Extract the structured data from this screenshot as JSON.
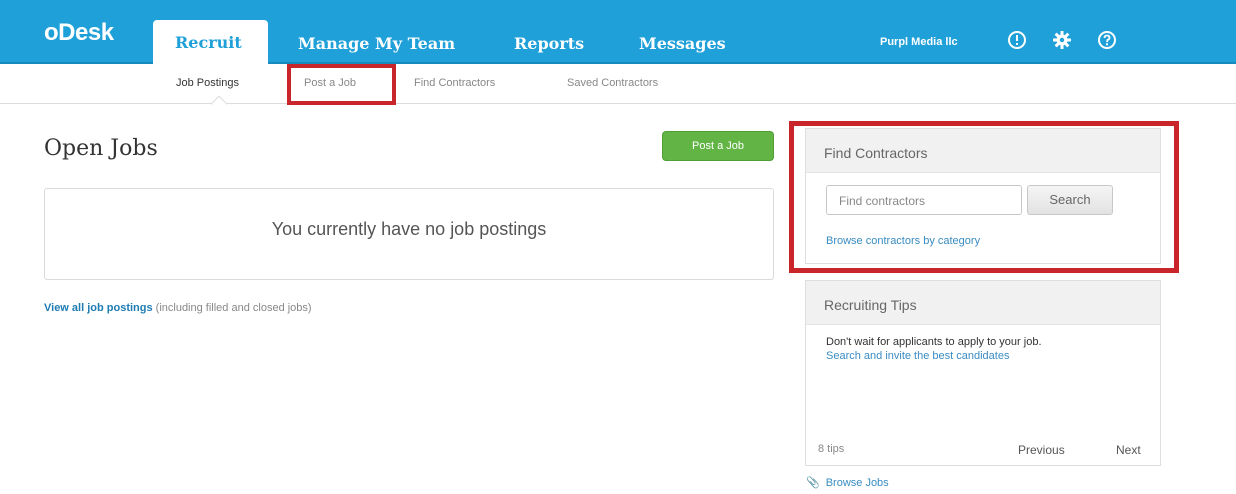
{
  "header": {
    "logo": "oDesk",
    "tabs": [
      {
        "label": "Recruit"
      },
      {
        "label": "Manage My Team"
      },
      {
        "label": "Reports"
      },
      {
        "label": "Messages"
      }
    ],
    "company": "Purpl Media llc",
    "icons": [
      "alert-icon",
      "gear-icon",
      "help-icon"
    ]
  },
  "subnav": {
    "items": [
      {
        "label": "Job Postings"
      },
      {
        "label": "Post a Job"
      },
      {
        "label": "Find Contractors"
      },
      {
        "label": "Saved Contractors"
      }
    ]
  },
  "main": {
    "title": "Open Jobs",
    "post_button": "Post a Job",
    "empty_message": "You currently have no job postings",
    "view_all_link": "View all job postings",
    "view_all_note": "(including filled and closed jobs)"
  },
  "find_panel": {
    "title": "Find Contractors",
    "search_placeholder": "Find contractors",
    "search_button": "Search",
    "browse_link": "Browse contractors by category"
  },
  "tips_panel": {
    "title": "Recruiting Tips",
    "text": "Don't wait for applicants to apply to your job.",
    "link": "Search and invite the best candidates",
    "count": "8 tips",
    "previous": "Previous",
    "next": "Next"
  },
  "browse_jobs": "Browse Jobs",
  "colors": {
    "topbar": "#1fa0d8",
    "highlight": "#c9262c",
    "post_button": "#62b545"
  }
}
